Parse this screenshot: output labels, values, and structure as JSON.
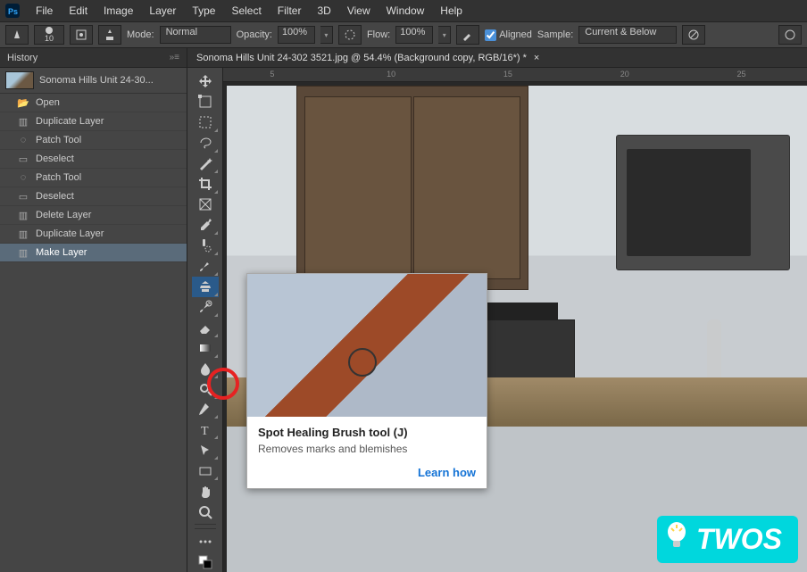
{
  "menubar": [
    "File",
    "Edit",
    "Image",
    "Layer",
    "Type",
    "Select",
    "Filter",
    "3D",
    "View",
    "Window",
    "Help"
  ],
  "options_bar": {
    "brush_size": "10",
    "mode_label": "Mode:",
    "mode_value": "Normal",
    "opacity_label": "Opacity:",
    "opacity_value": "100%",
    "flow_label": "Flow:",
    "flow_value": "100%",
    "aligned_label": "Aligned",
    "sample_label": "Sample:",
    "sample_value": "Current & Below"
  },
  "history": {
    "title": "History",
    "doc_name": "Sonoma Hills Unit 24-30...",
    "items": [
      {
        "label": "Open",
        "icon": "open"
      },
      {
        "label": "Duplicate Layer",
        "icon": "layer"
      },
      {
        "label": "Patch Tool",
        "icon": "patch"
      },
      {
        "label": "Deselect",
        "icon": "deselect"
      },
      {
        "label": "Patch Tool",
        "icon": "patch"
      },
      {
        "label": "Deselect",
        "icon": "deselect"
      },
      {
        "label": "Delete Layer",
        "icon": "layer"
      },
      {
        "label": "Duplicate Layer",
        "icon": "layer"
      },
      {
        "label": "Make Layer",
        "icon": "layer"
      }
    ],
    "selected_index": 8
  },
  "document": {
    "tab_title": "Sonoma Hills Unit 24-302 3521.jpg @ 54.4% (Background copy, RGB/16*) *"
  },
  "ruler_marks": [
    "5",
    "10",
    "15",
    "20",
    "25"
  ],
  "tooltip": {
    "title": "Spot Healing Brush tool (J)",
    "description": "Removes marks and blemishes",
    "link_label": "Learn how"
  },
  "overlay": {
    "brand": "TWOS"
  },
  "tools": [
    "move",
    "artboard",
    "marquee",
    "lasso",
    "magic-wand",
    "crop",
    "frame",
    "eyedropper",
    "spot-healing",
    "brush",
    "clone-stamp",
    "history-brush",
    "eraser",
    "gradient",
    "blur",
    "dodge",
    "pen",
    "type",
    "path-select",
    "rectangle",
    "hand",
    "zoom",
    "edit-toolbar",
    "fg-bg"
  ]
}
